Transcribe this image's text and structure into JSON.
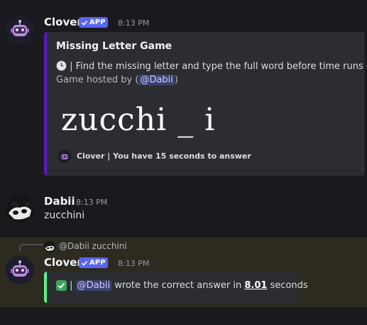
{
  "messages": [
    {
      "author": "Clover",
      "badge": "APP",
      "time": "8:13 PM",
      "embed": {
        "title": "Missing Letter Game",
        "description": "| Find the missing letter and type the full word before time runs out",
        "hosted_prefix": "Game hosted by (",
        "hosted_mention": "@Dabii",
        "hosted_suffix": ")",
        "puzzle": "zucchi _ i",
        "footer": "Clover | You have 15 seconds to answer",
        "accent_color": "#5b16c4"
      }
    },
    {
      "author": "Dabii",
      "time": "8:13 PM",
      "text": "zucchini"
    },
    {
      "reply": {
        "mention": "@Dabii",
        "text": "zucchini"
      },
      "author": "Clover",
      "badge": "APP",
      "time": "8:13 PM",
      "embed": {
        "separator": "|",
        "mention": "@Dabii",
        "text_before": "wrote the correct answer in",
        "seconds_value": "8.01",
        "text_after": "seconds",
        "accent_color": "#57f287"
      }
    }
  ],
  "icons": {
    "bot_avatar": "robot-icon",
    "user_avatar": "panda-avatar-icon",
    "clock": "clock-icon",
    "check": "checkmark-icon",
    "verified": "check-icon"
  }
}
